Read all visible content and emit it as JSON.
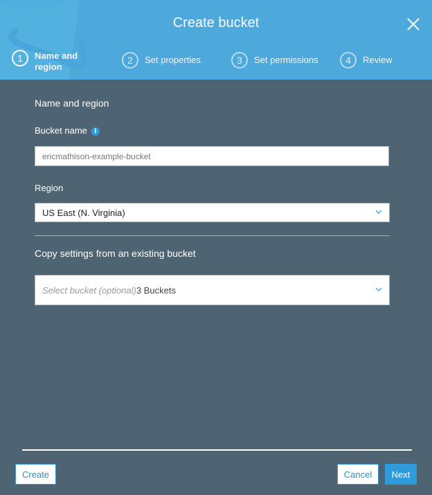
{
  "dialog": {
    "title": "Create bucket",
    "close_icon": "close-x-icon"
  },
  "steps": [
    {
      "number": "1",
      "label": "Name and region",
      "active": true
    },
    {
      "number": "2",
      "label": "Set properties",
      "active": false
    },
    {
      "number": "3",
      "label": "Set permissions",
      "active": false
    },
    {
      "number": "4",
      "label": "Review",
      "active": false
    }
  ],
  "form": {
    "section_title": "Name and region",
    "bucket_name": {
      "label": "Bucket name",
      "info_icon": "i",
      "value": "ericmathison-example-bucket"
    },
    "region": {
      "label": "Region",
      "selected": "US East (N. Virginia)"
    },
    "copy_settings": {
      "label": "Copy settings from an existing bucket",
      "placeholder": "Select bucket (optional)",
      "count": "3 Buckets"
    }
  },
  "footer": {
    "create_label": "Create",
    "cancel_label": "Cancel",
    "next_label": "Next"
  },
  "colors": {
    "header_bg": "#4da8db",
    "body_bg": "#4e6472",
    "accent": "#2f9bdc"
  }
}
